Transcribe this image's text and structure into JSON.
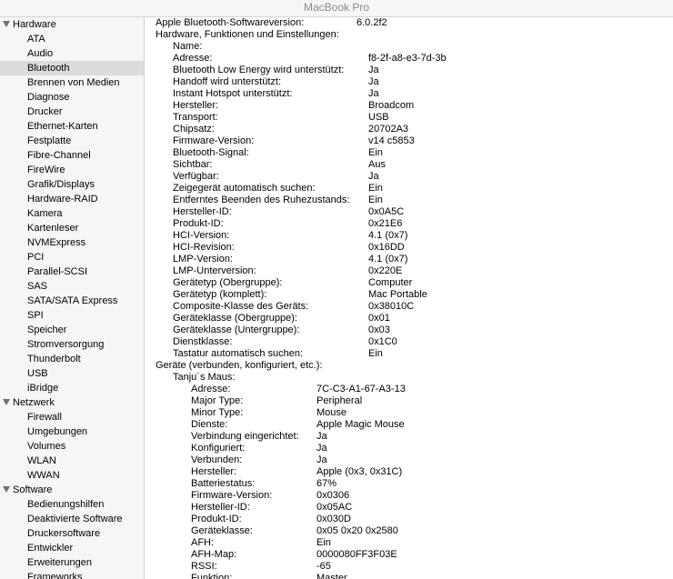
{
  "window": {
    "title": "MacBook Pro"
  },
  "sidebar": {
    "sections": [
      {
        "label": "Hardware",
        "items": [
          "ATA",
          "Audio",
          "Bluetooth",
          "Brennen von Medien",
          "Diagnose",
          "Drucker",
          "Ethernet-Karten",
          "Festplatte",
          "Fibre-Channel",
          "FireWire",
          "Grafik/Displays",
          "Hardware-RAID",
          "Kamera",
          "Kartenleser",
          "NVMExpress",
          "PCI",
          "Parallel-SCSI",
          "SAS",
          "SATA/SATA Express",
          "SPI",
          "Speicher",
          "Stromversorgung",
          "Thunderbolt",
          "USB",
          "iBridge"
        ]
      },
      {
        "label": "Netzwerk",
        "items": [
          "Firewall",
          "Umgebungen",
          "Volumes",
          "WLAN",
          "WWAN"
        ]
      },
      {
        "label": "Software",
        "items": [
          "Bedienungshilfen",
          "Deaktivierte Software",
          "Druckersoftware",
          "Entwickler",
          "Erweiterungen",
          "Frameworks"
        ]
      }
    ],
    "selected": "Bluetooth"
  },
  "content": {
    "rows": [
      {
        "level": 0,
        "tab": 0,
        "key": "Apple Bluetooth-Softwareversion:",
        "value": "6.0.2f2"
      },
      {
        "level": 0,
        "tab": 0,
        "key": "Hardware, Funktionen und Einstellungen:",
        "value": ""
      },
      {
        "level": 1,
        "tab": 1,
        "key": "Name:",
        "value": ""
      },
      {
        "level": 1,
        "tab": 1,
        "key": "Adresse:",
        "value": "f8-2f-a8-e3-7d-3b"
      },
      {
        "level": 1,
        "tab": 1,
        "key": "Bluetooth Low Energy wird unterstützt:",
        "value": "Ja"
      },
      {
        "level": 1,
        "tab": 1,
        "key": "Handoff wird unterstützt:",
        "value": "Ja"
      },
      {
        "level": 1,
        "tab": 1,
        "key": "Instant Hotspot unterstützt:",
        "value": "Ja"
      },
      {
        "level": 1,
        "tab": 1,
        "key": "Hersteller:",
        "value": "Broadcom"
      },
      {
        "level": 1,
        "tab": 1,
        "key": "Transport:",
        "value": "USB"
      },
      {
        "level": 1,
        "tab": 1,
        "key": "Chipsatz:",
        "value": "20702A3"
      },
      {
        "level": 1,
        "tab": 1,
        "key": "Firmware-Version:",
        "value": "v14 c5853"
      },
      {
        "level": 1,
        "tab": 1,
        "key": "Bluetooth-Signal:",
        "value": "Ein"
      },
      {
        "level": 1,
        "tab": 1,
        "key": "Sichtbar:",
        "value": "Aus"
      },
      {
        "level": 1,
        "tab": 1,
        "key": "Verfügbar:",
        "value": "Ja"
      },
      {
        "level": 1,
        "tab": 1,
        "key": "Zeigegerät automatisch suchen:",
        "value": "Ein"
      },
      {
        "level": 1,
        "tab": 1,
        "key": "Entferntes Beenden des Ruhezustands:",
        "value": "Ein"
      },
      {
        "level": 1,
        "tab": 1,
        "key": "Hersteller-ID:",
        "value": "0x0A5C"
      },
      {
        "level": 1,
        "tab": 1,
        "key": "Produkt-ID:",
        "value": "0x21E6"
      },
      {
        "level": 1,
        "tab": 1,
        "key": "HCI-Version:",
        "value": "4.1 (0x7)"
      },
      {
        "level": 1,
        "tab": 1,
        "key": "HCI-Revision:",
        "value": "0x16DD"
      },
      {
        "level": 1,
        "tab": 1,
        "key": "LMP-Version:",
        "value": "4.1 (0x7)"
      },
      {
        "level": 1,
        "tab": 1,
        "key": "LMP-Unterversion:",
        "value": "0x220E"
      },
      {
        "level": 1,
        "tab": 1,
        "key": "Gerätetyp (Obergruppe):",
        "value": "Computer"
      },
      {
        "level": 1,
        "tab": 1,
        "key": "Gerätetyp (komplett):",
        "value": "Mac Portable"
      },
      {
        "level": 1,
        "tab": 1,
        "key": "Composite-Klasse des Geräts:",
        "value": "0x38010C"
      },
      {
        "level": 1,
        "tab": 1,
        "key": "Geräteklasse (Obergruppe):",
        "value": "0x01"
      },
      {
        "level": 1,
        "tab": 1,
        "key": "Geräteklasse (Untergruppe):",
        "value": "0x03"
      },
      {
        "level": 1,
        "tab": 1,
        "key": "Dienstklasse:",
        "value": "0x1C0"
      },
      {
        "level": 1,
        "tab": 1,
        "key": "Tastatur automatisch suchen:",
        "value": "Ein"
      },
      {
        "level": 0,
        "tab": 0,
        "key": "Geräte (verbunden, konfiguriert, etc.):",
        "value": ""
      },
      {
        "level": 1,
        "tab": 1,
        "key": "Tanju´s Maus:",
        "value": ""
      },
      {
        "level": 2,
        "tab": 2,
        "key": "Adresse:",
        "value": "7C-C3-A1-67-A3-13"
      },
      {
        "level": 2,
        "tab": 2,
        "key": "Major Type:",
        "value": "Peripheral"
      },
      {
        "level": 2,
        "tab": 2,
        "key": "Minor Type:",
        "value": "Mouse"
      },
      {
        "level": 2,
        "tab": 2,
        "key": "Dienste:",
        "value": "Apple Magic Mouse"
      },
      {
        "level": 2,
        "tab": 2,
        "key": "Verbindung eingerichtet:",
        "value": "Ja"
      },
      {
        "level": 2,
        "tab": 2,
        "key": "Konfiguriert:",
        "value": "Ja"
      },
      {
        "level": 2,
        "tab": 2,
        "key": "Verbunden:",
        "value": "Ja"
      },
      {
        "level": 2,
        "tab": 2,
        "key": "Hersteller:",
        "value": "Apple (0x3, 0x31C)"
      },
      {
        "level": 2,
        "tab": 2,
        "key": "Batteriestatus:",
        "value": "67%"
      },
      {
        "level": 2,
        "tab": 2,
        "key": "Firmware-Version:",
        "value": "0x0306"
      },
      {
        "level": 2,
        "tab": 2,
        "key": "Hersteller-ID:",
        "value": "0x05AC"
      },
      {
        "level": 2,
        "tab": 2,
        "key": "Produkt-ID:",
        "value": "0x030D"
      },
      {
        "level": 2,
        "tab": 2,
        "key": "Geräteklasse:",
        "value": "0x05 0x20 0x2580"
      },
      {
        "level": 2,
        "tab": 2,
        "key": "AFH:",
        "value": "Ein"
      },
      {
        "level": 2,
        "tab": 2,
        "key": "AFH-Map:",
        "value": "0000080FF3F03E"
      },
      {
        "level": 2,
        "tab": 2,
        "key": "RSSI:",
        "value": "-65"
      },
      {
        "level": 2,
        "tab": 2,
        "key": "Funktion:",
        "value": "Master"
      }
    ]
  }
}
